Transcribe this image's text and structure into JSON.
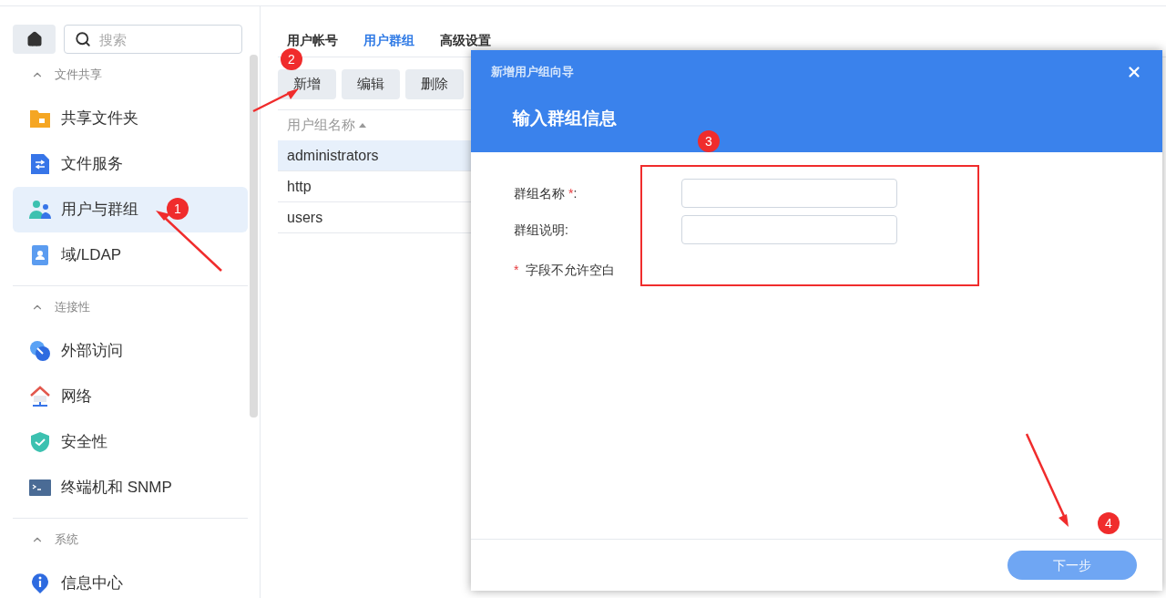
{
  "sidebar": {
    "search": {
      "placeholder": "搜索"
    },
    "sections": [
      {
        "title": "文件共享",
        "expanded": true,
        "items": [
          {
            "label": "共享文件夹",
            "kind": "folder",
            "selected": false
          },
          {
            "label": "文件服务",
            "kind": "file",
            "selected": false
          },
          {
            "label": "用户与群组",
            "kind": "users",
            "selected": true
          },
          {
            "label": "域/LDAP",
            "kind": "contact",
            "selected": false
          }
        ]
      },
      {
        "title": "连接性",
        "expanded": true,
        "items": [
          {
            "label": "外部访问",
            "kind": "link",
            "selected": false
          },
          {
            "label": "网络",
            "kind": "house",
            "selected": false
          },
          {
            "label": "安全性",
            "kind": "shield",
            "selected": false
          },
          {
            "label": "终端机和 SNMP",
            "kind": "terminal",
            "selected": false
          }
        ]
      },
      {
        "title": "系统",
        "expanded": true,
        "items": [
          {
            "label": "信息中心",
            "kind": "info",
            "selected": false
          }
        ]
      }
    ]
  },
  "tabs": [
    {
      "label": "用户帐号",
      "selected": false
    },
    {
      "label": "用户群组",
      "selected": true
    },
    {
      "label": "高级设置",
      "selected": false
    }
  ],
  "toolbar": [
    "新增",
    "编辑",
    "删除"
  ],
  "table": {
    "columns": [
      {
        "label": "用户组名称",
        "sorted": true
      }
    ],
    "rows": [
      {
        "name": "administrators",
        "selected": true
      },
      {
        "name": "http",
        "selected": false
      },
      {
        "name": "users",
        "selected": false
      }
    ]
  },
  "dialog": {
    "title": "新增用户组向导",
    "heading": "输入群组信息",
    "fields": [
      {
        "label": "群组名称",
        "required_mark": "*",
        "colon": ":"
      },
      {
        "label": "群组说明",
        "colon": ":"
      }
    ],
    "note": {
      "mark": "*",
      "text": "字段不允许空白"
    },
    "next_button": {
      "label": "下一步",
      "disabled": true
    }
  },
  "annotations": [
    {
      "kind": "badge",
      "label": "1"
    },
    {
      "kind": "badge",
      "label": "2"
    },
    {
      "kind": "badge",
      "label": "3"
    },
    {
      "kind": "badge",
      "label": "4"
    }
  ]
}
